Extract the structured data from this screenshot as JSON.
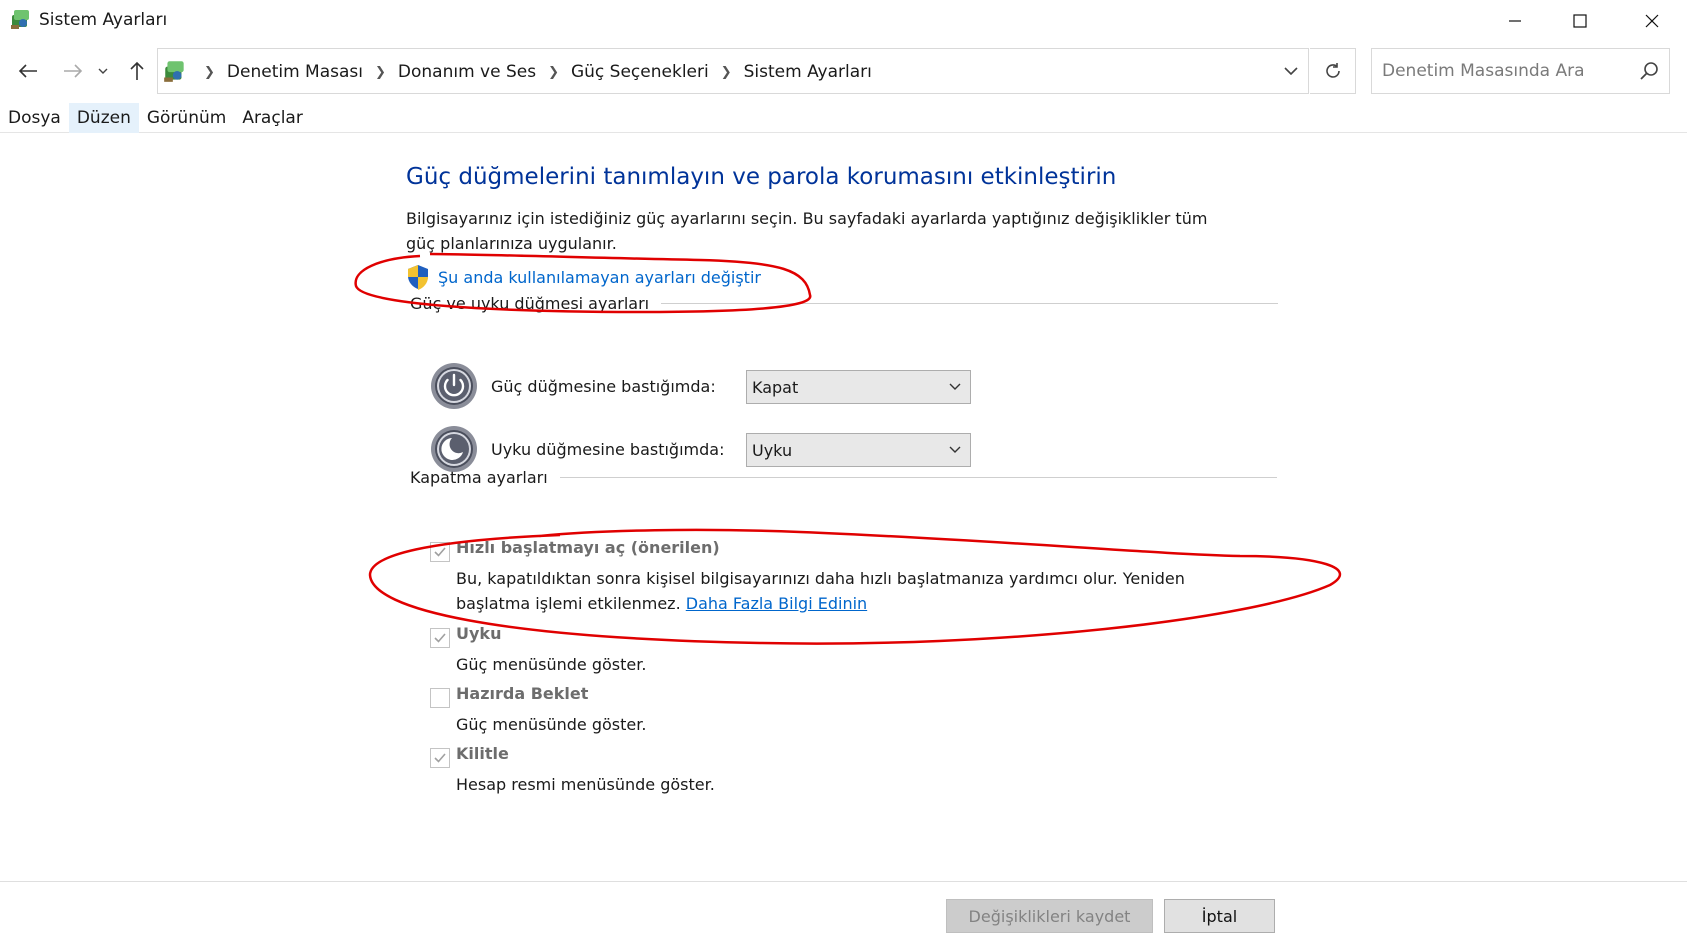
{
  "window": {
    "title": "Sistem Ayarları",
    "controls": {
      "minimize": "—",
      "maximize": "☐",
      "close": "✕"
    }
  },
  "nav": {
    "breadcrumbs": [
      "Denetim Masası",
      "Donanım ve Ses",
      "Güç Seçenekleri",
      "Sistem Ayarları"
    ],
    "search_placeholder": "Denetim Masasında Ara"
  },
  "menu": {
    "items": [
      "Dosya",
      "Düzen",
      "Görünüm",
      "Araçlar"
    ],
    "active_index": 1
  },
  "page": {
    "heading": "Güç düğmelerini tanımlayın ve parola korumasını etkinleştirin",
    "description": "Bilgisayarınız için istediğiniz güç ayarlarını seçin. Bu sayfadaki ayarlarda yaptığınız değişiklikler tüm güç planlarınıza uygulanır.",
    "admin_link": "Şu anda kullanılamayan ayarları değiştir"
  },
  "power_section": {
    "title": "Güç ve uyku düğmesi ayarları",
    "rows": [
      {
        "label": "Güç düğmesine bastığımda:",
        "value": "Kapat"
      },
      {
        "label": "Uyku düğmesine bastığımda:",
        "value": "Uyku"
      }
    ]
  },
  "shutdown_section": {
    "title": "Kapatma ayarları",
    "options": [
      {
        "title": "Hızlı başlatmayı aç (önerilen)",
        "desc": "Bu, kapatıldıktan sonra kişisel bilgisayarınızı daha hızlı başlatmanıza yardımcı olur. Yeniden başlatma işlemi etkilenmez.",
        "link": "Daha Fazla Bilgi Edinin",
        "checked": true
      },
      {
        "title": "Uyku",
        "desc": "Güç menüsünde göster.",
        "checked": true
      },
      {
        "title": "Hazırda Beklet",
        "desc": "Güç menüsünde göster.",
        "checked": false
      },
      {
        "title": "Kilitle",
        "desc": "Hesap resmi menüsünde göster.",
        "checked": true
      }
    ]
  },
  "footer": {
    "save_label": "Değişiklikleri kaydet",
    "cancel_label": "İptal"
  },
  "colors": {
    "heading": "#003399",
    "link": "#0066cc",
    "annotation": "#e00000"
  }
}
